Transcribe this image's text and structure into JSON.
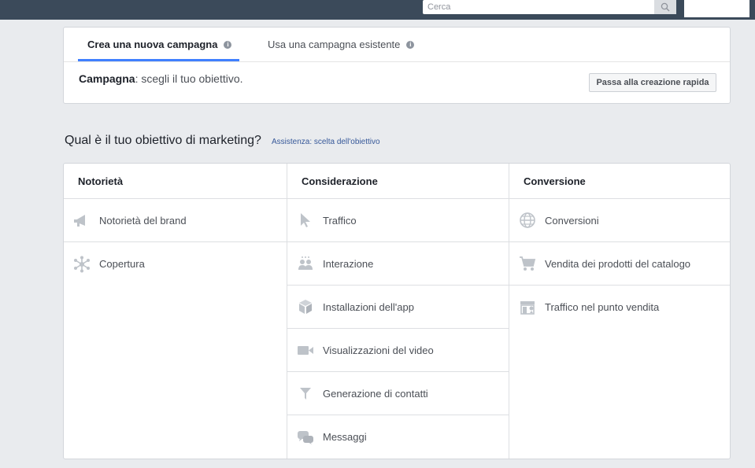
{
  "topbar": {
    "search_placeholder": "Cerca"
  },
  "tabs": [
    {
      "label": "Crea una nuova campagna",
      "active": true
    },
    {
      "label": "Usa una campagna esistente",
      "active": false
    }
  ],
  "campaign": {
    "label_bold": "Campagna",
    "label_rest": ": scegli il tuo obiettivo.",
    "quick_button": "Passa alla creazione rapida"
  },
  "objective": {
    "question": "Qual è il tuo obiettivo di marketing?",
    "help_link": "Assistenza: scelta dell'obiettivo"
  },
  "columns": [
    {
      "title": "Notorietà",
      "items": [
        {
          "label": "Notorietà del brand",
          "icon": "megaphone-icon"
        },
        {
          "label": "Copertura",
          "icon": "reach-icon"
        }
      ]
    },
    {
      "title": "Considerazione",
      "items": [
        {
          "label": "Traffico",
          "icon": "cursor-icon"
        },
        {
          "label": "Interazione",
          "icon": "people-icon"
        },
        {
          "label": "Installazioni dell'app",
          "icon": "box-icon"
        },
        {
          "label": "Visualizzazioni del video",
          "icon": "video-icon"
        },
        {
          "label": "Generazione di contatti",
          "icon": "funnel-icon"
        },
        {
          "label": "Messaggi",
          "icon": "chat-icon"
        }
      ]
    },
    {
      "title": "Conversione",
      "items": [
        {
          "label": "Conversioni",
          "icon": "globe-icon"
        },
        {
          "label": "Vendita dei prodotti del catalogo",
          "icon": "cart-icon"
        },
        {
          "label": "Traffico nel punto vendita",
          "icon": "store-icon"
        }
      ]
    }
  ],
  "colors": {
    "topbar": "#3b4a5a",
    "accent": "#4080ff",
    "icon": "#bec3c9",
    "link": "#365899"
  }
}
